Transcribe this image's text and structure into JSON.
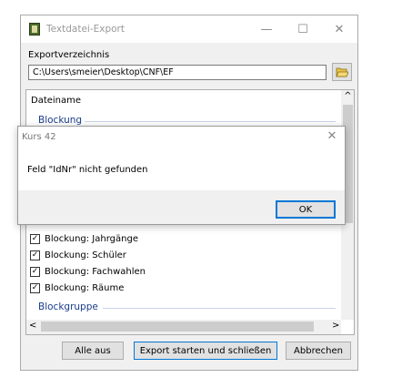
{
  "window": {
    "title": "Textdatei-Export",
    "minimize_glyph": "—",
    "maximize_glyph": "☐",
    "close_glyph": "✕"
  },
  "export_dir": {
    "label": "Exportverzeichnis",
    "value": "C:\\Users\\smeier\\Desktop\\CNF\\EF"
  },
  "list": {
    "header": "Dateiname",
    "group_top": "Blockung",
    "items": [
      {
        "label": "Blockung: Jahrgänge",
        "checked": true
      },
      {
        "label": "Blockung: Schüler",
        "checked": true
      },
      {
        "label": "Blockung: Fachwahlen",
        "checked": true
      },
      {
        "label": "Blockung: Räume",
        "checked": true
      }
    ],
    "group_bottom": "Blockgruppe",
    "scroll_up": "^",
    "scroll_left": "<",
    "scroll_right": ">"
  },
  "buttons": {
    "clear_all": "Alle aus",
    "start_export": "Export starten und schließen",
    "cancel": "Abbrechen"
  },
  "dialog": {
    "title": "Kurs 42",
    "message": "Feld \"IdNr\" nicht gefunden",
    "ok": "OK",
    "close_glyph": "✕"
  },
  "icons": {
    "app": "app-icon",
    "folder": "folder-open-icon"
  },
  "colors": {
    "group_heading": "#1a3c8c",
    "focus_border": "#0078d7"
  }
}
